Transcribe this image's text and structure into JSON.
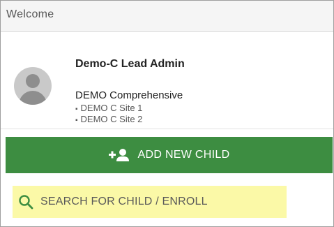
{
  "header": {
    "title": "Welcome"
  },
  "profile": {
    "name": "Demo-C Lead Admin",
    "organization": "DEMO Comprehensive",
    "sites": [
      "DEMO C Site 1",
      "DEMO C Site 2"
    ]
  },
  "actions": {
    "add_child_label": "ADD NEW CHILD",
    "add_child_icon": "add-person-icon",
    "search_label": "SEARCH FOR CHILD / ENROLL",
    "search_icon": "search-icon"
  },
  "colors": {
    "add_button_bg": "#3d8d41",
    "search_highlight": "#fbf9a7",
    "search_icon": "#3d8d41"
  }
}
